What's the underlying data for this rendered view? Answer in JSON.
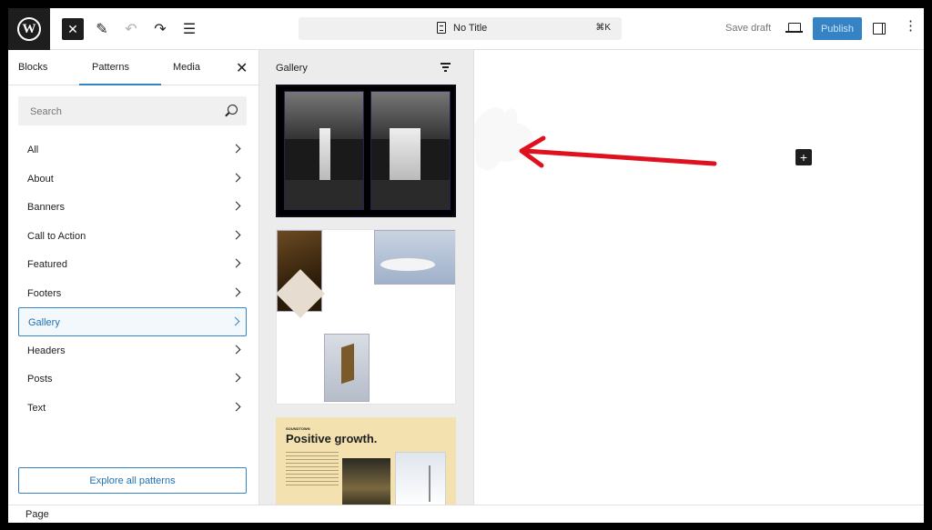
{
  "header": {
    "doc_title": "No Title",
    "shortcut": "⌘K",
    "save_draft": "Save draft",
    "publish": "Publish",
    "kebab": "⋮",
    "close_glyph": "✕",
    "pen_glyph": "✎",
    "undo_glyph": "↶",
    "redo_glyph": "↷",
    "list_glyph": "☰",
    "logo_letter": "W"
  },
  "inserter": {
    "tabs": [
      "Blocks",
      "Patterns",
      "Media"
    ],
    "active_tab": "Patterns",
    "close_glyph": "✕",
    "search_placeholder": "Search",
    "categories": [
      "All",
      "About",
      "Banners",
      "Call to Action",
      "Featured",
      "Footers",
      "Gallery",
      "Headers",
      "Posts",
      "Text"
    ],
    "active_category": "Gallery",
    "explore_label": "Explore all patterns"
  },
  "gallery": {
    "title": "Gallery",
    "card3_brand": "SOUNDTOWN",
    "card3_title": "Positive growth."
  },
  "canvas": {
    "add_glyph": "+"
  },
  "footer": {
    "breadcrumb": "Page"
  },
  "colors": {
    "accent": "#3582c4",
    "annotation_arrow": "#e0111f"
  }
}
